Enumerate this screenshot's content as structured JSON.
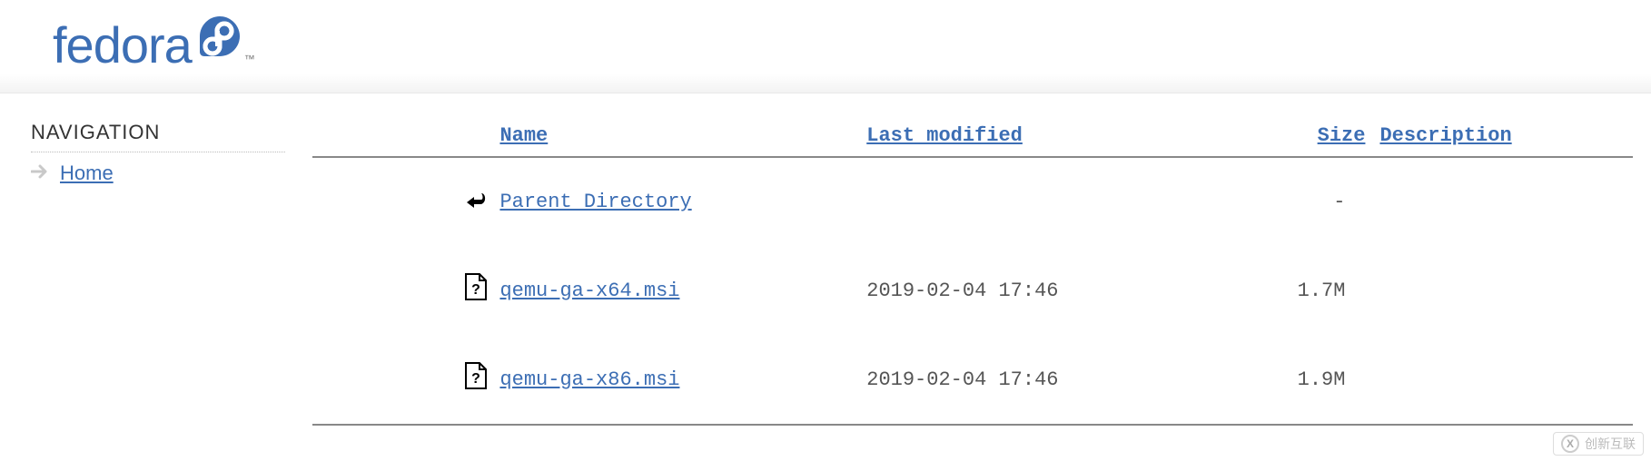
{
  "brand": {
    "name": "fedora"
  },
  "sidebar": {
    "title": "NAVIGATION",
    "items": [
      {
        "label": "Home"
      }
    ]
  },
  "listing": {
    "headers": {
      "name": "Name",
      "modified": "Last modified",
      "size": "Size",
      "description": "Description"
    },
    "rows": [
      {
        "icon": "back",
        "name": "Parent Directory",
        "modified": "",
        "size": "-",
        "description": ""
      },
      {
        "icon": "unknown",
        "name": "qemu-ga-x64.msi",
        "modified": "2019-02-04 17:46",
        "size": "1.7M",
        "description": ""
      },
      {
        "icon": "unknown",
        "name": "qemu-ga-x86.msi",
        "modified": "2019-02-04 17:46",
        "size": "1.9M",
        "description": ""
      }
    ]
  },
  "watermark": {
    "label": "创新互联"
  }
}
